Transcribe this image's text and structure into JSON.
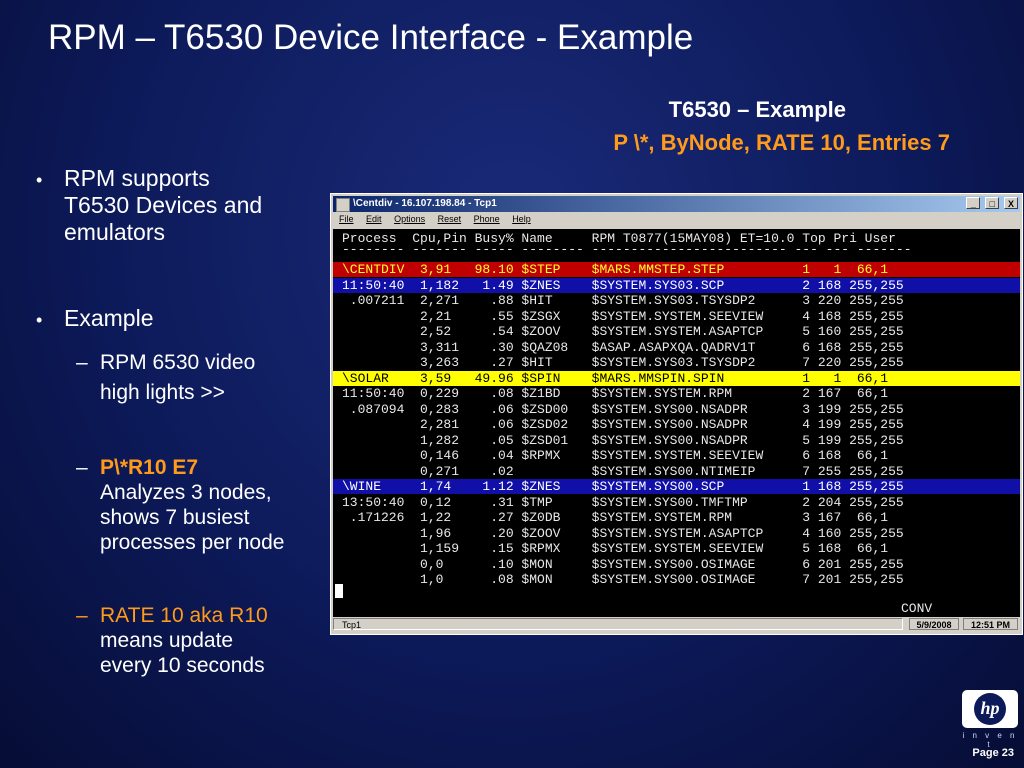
{
  "title": "RPM – T6530 Device Interface - Example",
  "example": {
    "line1": "T6530 – Example",
    "line2": "P \\*, ByNode, RATE 10, Entries 7"
  },
  "bullets": [
    {
      "lines": [
        "RPM supports",
        "T6530 Devices and",
        "emulators"
      ]
    },
    {
      "text": "Example"
    }
  ],
  "subbullets": {
    "s1": [
      "RPM 6530 video",
      "high lights >>"
    ],
    "s2_head": "P\\*R10 E7",
    "s2": [
      "Analyzes 3 nodes,",
      "shows 7 busiest",
      "processes per node"
    ],
    "s3_head": "RATE 10 aka R10",
    "s3": [
      "means update",
      "every 10 seconds"
    ]
  },
  "window": {
    "title": "\\Centdiv - 16.107.198.84 - Tcp1",
    "menu": [
      "File",
      "Edit",
      "Options",
      "Reset",
      "Phone",
      "Help"
    ],
    "buttons": [
      "_",
      "□",
      "X"
    ],
    "status": {
      "session": "Tcp1",
      "date": "5/9/2008",
      "time": "12:51 PM"
    }
  },
  "terminal": {
    "header": "Process  Cpu,Pin Busy% Name     RPM T0877(15MAY08) ET=10.0 Top Pri User",
    "underline": "-------- ------- ----- -------- ------------------------- --- --- -------",
    "rows": [
      {
        "text": "\\CENTDIV  3,91   98.10 $STEP    $MARS.MMSTEP.STEP          1   1  66,1",
        "style": "red"
      },
      {
        "text": "11:50:40  1,182   1.49 $ZNES    $SYSTEM.SYS03.SCP          2 168 255,255",
        "style": "blue"
      },
      {
        "text": " .007211  2,271    .88 $HIT     $SYSTEM.SYS03.TSYSDP2      3 220 255,255",
        "style": ""
      },
      {
        "text": "          2,21     .55 $ZSGX    $SYSTEM.SYSTEM.SEEVIEW     4 168 255,255",
        "style": ""
      },
      {
        "text": "          2,52     .54 $ZOOV    $SYSTEM.SYSTEM.ASAPTCP     5 160 255,255",
        "style": ""
      },
      {
        "text": "          3,311    .30 $QAZ08   $ASAP.ASAPXQA.QADRV1T      6 168 255,255",
        "style": ""
      },
      {
        "text": "          3,263    .27 $HIT     $SYSTEM.SYS03.TSYSDP2      7 220 255,255",
        "style": ""
      },
      {
        "text": "\\SOLAR    3,59   49.96 $SPIN    $MARS.MMSPIN.SPIN          1   1  66,1",
        "style": "yellow"
      },
      {
        "text": "11:50:40  0,229    .08 $Z1BD    $SYSTEM.SYSTEM.RPM         2 167  66,1",
        "style": ""
      },
      {
        "text": " .087094  0,283    .06 $ZSD00   $SYSTEM.SYS00.NSADPR       3 199 255,255",
        "style": ""
      },
      {
        "text": "          2,281    .06 $ZSD02   $SYSTEM.SYS00.NSADPR       4 199 255,255",
        "style": ""
      },
      {
        "text": "          1,282    .05 $ZSD01   $SYSTEM.SYS00.NSADPR       5 199 255,255",
        "style": ""
      },
      {
        "text": "          0,146    .04 $RPMX    $SYSTEM.SYSTEM.SEEVIEW     6 168  66,1",
        "style": ""
      },
      {
        "text": "          0,271    .02          $SYSTEM.SYS00.NTIMEIP      7 255 255,255",
        "style": ""
      },
      {
        "text": "\\WINE     1,74    1.12 $ZNES    $SYSTEM.SYS00.SCP          1 168 255,255",
        "style": "blue"
      },
      {
        "text": "13:50:40  0,12     .31 $TMP     $SYSTEM.SYS00.TMFTMP       2 204 255,255",
        "style": ""
      },
      {
        "text": " .171226  1,22     .27 $Z0DB    $SYSTEM.SYSTEM.RPM         3 167  66,1",
        "style": ""
      },
      {
        "text": "          1,96     .20 $ZOOV    $SYSTEM.SYSTEM.ASAPTCP     4 160 255,255",
        "style": ""
      },
      {
        "text": "          1,159    .15 $RPMX    $SYSTEM.SYSTEM.SEEVIEW     5 168  66,1",
        "style": ""
      },
      {
        "text": "          0,0      .10 $MON     $SYSTEM.SYS00.OSIMAGE      6 201 255,255",
        "style": ""
      },
      {
        "text": "          1,0      .08 $MON     $SYSTEM.SYS00.OSIMAGE      7 201 255,255",
        "style": ""
      }
    ],
    "conv": "CONV",
    "colors": {
      "red": "#c00000",
      "blue": "#1010a8",
      "yellow": "#ffff00"
    }
  },
  "logo": {
    "text": "hp",
    "tagline": "i n v e n t"
  },
  "page": "Page 23"
}
